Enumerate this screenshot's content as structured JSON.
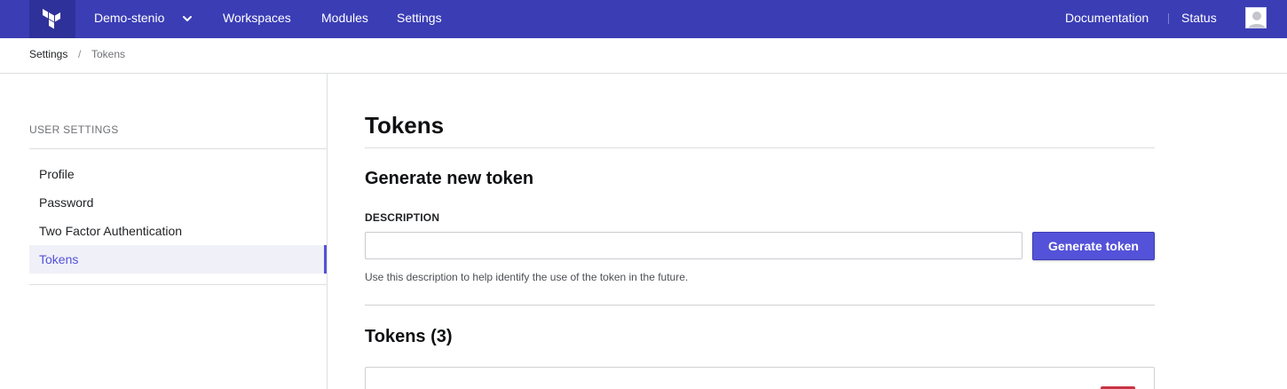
{
  "nav": {
    "org_name": "Demo-stenio",
    "workspaces": "Workspaces",
    "modules": "Modules",
    "settings": "Settings",
    "documentation": "Documentation",
    "status": "Status"
  },
  "breadcrumb": {
    "parent": "Settings",
    "separator": "/",
    "current": "Tokens"
  },
  "sidebar": {
    "heading": "USER SETTINGS",
    "items": [
      {
        "label": "Profile"
      },
      {
        "label": "Password"
      },
      {
        "label": "Two Factor Authentication"
      },
      {
        "label": "Tokens",
        "active": true
      }
    ]
  },
  "main": {
    "title": "Tokens",
    "generate_title": "Generate new token",
    "description_label": "DESCRIPTION",
    "description_value": "",
    "generate_button": "Generate token",
    "help_text": "Use this description to help identify the use of the token in the future.",
    "tokens_title": "Tokens (3)"
  },
  "colors": {
    "nav_bg": "#3b3db5",
    "accent": "#5452d8",
    "danger": "#c73445"
  }
}
